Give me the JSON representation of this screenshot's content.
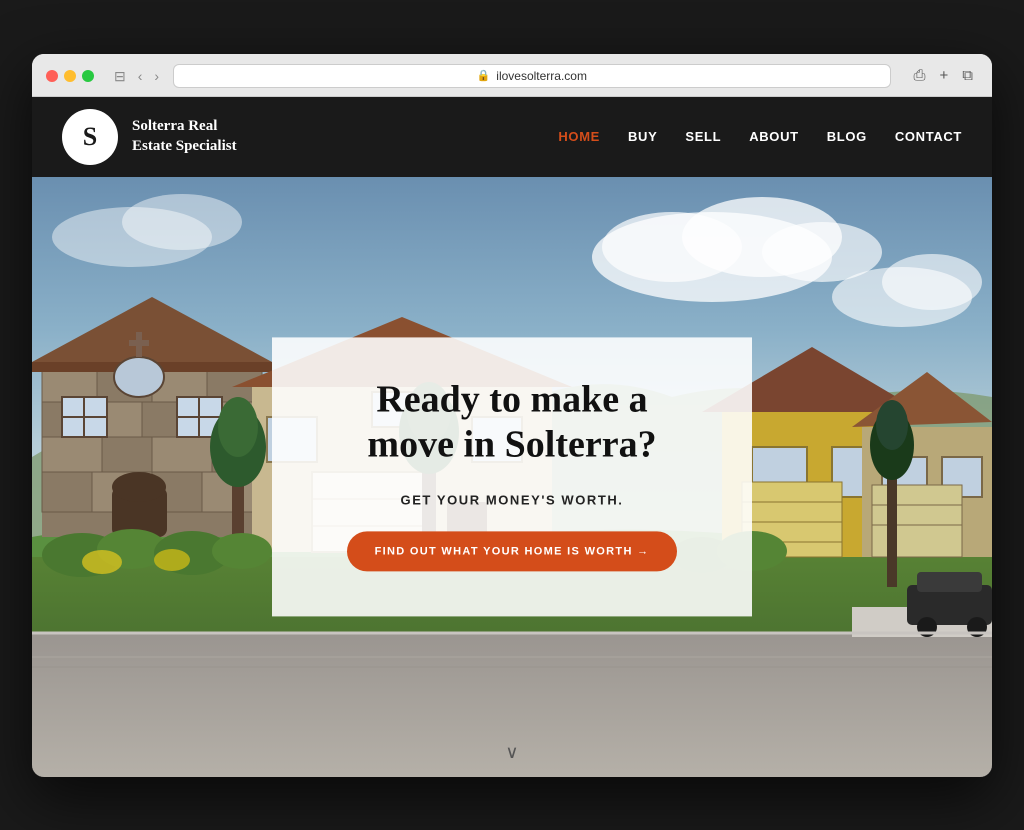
{
  "browser": {
    "url": "ilovesolterra.com",
    "reload_label": "↻"
  },
  "header": {
    "logo_letter": "S",
    "logo_line1": "Solterra Real",
    "logo_line2": "Estate Specialist",
    "nav": [
      {
        "id": "home",
        "label": "HOME",
        "active": true
      },
      {
        "id": "buy",
        "label": "BUY",
        "active": false
      },
      {
        "id": "sell",
        "label": "SELL",
        "active": false
      },
      {
        "id": "about",
        "label": "ABOUT",
        "active": false
      },
      {
        "id": "blog",
        "label": "BLOG",
        "active": false
      },
      {
        "id": "contact",
        "label": "CONTACT",
        "active": false
      }
    ]
  },
  "hero": {
    "headline": "Ready to make a move in Solterra?",
    "subtext": "GET YOUR MONEY'S WORTH.",
    "cta_label": "FIND OUT WHAT YOUR HOME IS WORTH →",
    "scroll_icon": "∨"
  },
  "colors": {
    "accent": "#d44d1a",
    "nav_active": "#d44d1a",
    "header_bg": "#1a1a1a",
    "logo_bg": "#ffffff",
    "logo_text": "#1a1a1a"
  }
}
